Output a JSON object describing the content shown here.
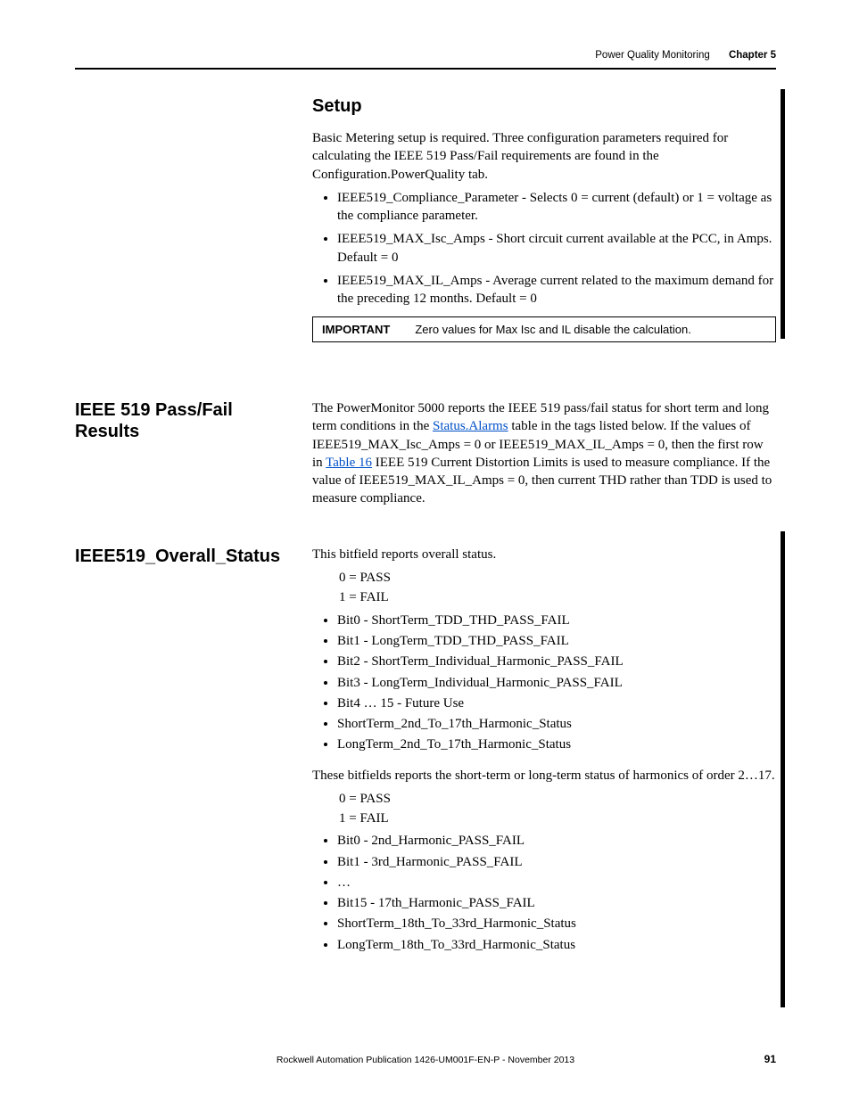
{
  "header": {
    "title": "Power Quality Monitoring",
    "chapter": "Chapter 5"
  },
  "setup": {
    "heading": "Setup",
    "intro": "Basic Metering setup is required. Three configuration parameters required for calculating the IEEE 519 Pass/Fail requirements are found in the Configuration.PowerQuality tab.",
    "bullets": [
      "IEEE519_Compliance_Parameter - Selects 0 = current (default) or 1 = voltage as the compliance parameter.",
      "IEEE519_MAX_Isc_Amps - Short circuit current available at the PCC, in Amps. Default = 0",
      "IEEE519_MAX_IL_Amps - Average current related to the maximum demand for the preceding 12 months. Default = 0"
    ],
    "important_label": "IMPORTANT",
    "important_text": "Zero values for Max Isc and IL disable the calculation."
  },
  "results": {
    "heading": "IEEE 519 Pass/Fail Results",
    "p_before_link1": "The PowerMonitor 5000 reports the IEEE 519 pass/fail status for short term and long term conditions in the ",
    "link1_text": "Status.Alarms",
    "p_between": " table in the tags listed below. If the values of IEEE519_MAX_Isc_Amps = 0 or IEEE519_MAX_IL_Amps = 0, then the first row in ",
    "link2_text": "Table 16",
    "p_after_link2": " IEEE 519 Current Distortion Limits is used to measure compliance. If the value of IEEE519_MAX_IL_Amps = 0, then current THD rather than TDD is used to measure compliance."
  },
  "overall": {
    "heading": "IEEE519_Overall_Status",
    "intro": "This bitfield reports overall status.",
    "pass": "0 = PASS",
    "fail": "1 = FAIL",
    "bullets": [
      "Bit0 - ShortTerm_TDD_THD_PASS_FAIL",
      "Bit1 - LongTerm_TDD_THD_PASS_FAIL",
      "Bit2 - ShortTerm_Individual_Harmonic_PASS_FAIL",
      "Bit3 - LongTerm_Individual_Harmonic_PASS_FAIL",
      "Bit4 … 15 - Future Use",
      "ShortTerm_2nd_To_17th_Harmonic_Status",
      "LongTerm_2nd_To_17th_Harmonic_Status"
    ],
    "para2": "These bitfields reports the short-term or long-term status of harmonics of order 2…17.",
    "pass2": "0 = PASS",
    "fail2": "1 = FAIL",
    "bullets2": [
      "Bit0 - 2nd_Harmonic_PASS_FAIL",
      "Bit1 - 3rd_Harmonic_PASS_FAIL",
      "…",
      "Bit15 - 17th_Harmonic_PASS_FAIL",
      "ShortTerm_18th_To_33rd_Harmonic_Status",
      "LongTerm_18th_To_33rd_Harmonic_Status"
    ]
  },
  "footer": {
    "pub": "Rockwell Automation Publication 1426-UM001F-EN-P - November 2013",
    "page": "91"
  }
}
